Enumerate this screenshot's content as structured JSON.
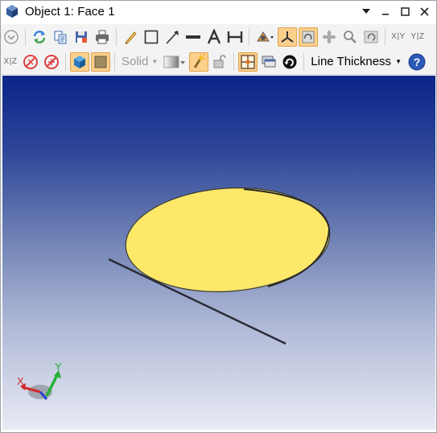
{
  "window": {
    "title": "Object 1: Face 1"
  },
  "toolbar2": {
    "shading_mode": "Solid",
    "line_thickness_label": "Line Thickness"
  },
  "scene": {
    "face_color": "#fde86a",
    "background_top": "#0a2488",
    "background_bottom": "#e9ebf4",
    "axis_labels": {
      "x": "X",
      "y": "Y"
    }
  },
  "icons": {
    "toolbar1": [
      "chevron-circle-icon",
      "refresh-icon",
      "copy-icon",
      "save-icon",
      "print-icon",
      "pencil-icon",
      "rectangle-icon",
      "arrow-line-icon",
      "line-icon",
      "text-icon",
      "dimension-icon",
      "camera-icon",
      "axis-view-icon",
      "rotate-view-icon",
      "pan-icon",
      "zoom-icon",
      "reset-view-icon",
      "xy-plane-icon",
      "yz-plane-icon"
    ],
    "toolbar2": [
      "xz-plane-icon",
      "no-rotate-icon",
      "no-rotate2-icon",
      "3d-cube-icon",
      "solid-box-icon",
      "gradient-icon",
      "light-icon",
      "lock-icon",
      "grid-icon",
      "layers-icon",
      "orbit-icon",
      "help-icon"
    ]
  }
}
